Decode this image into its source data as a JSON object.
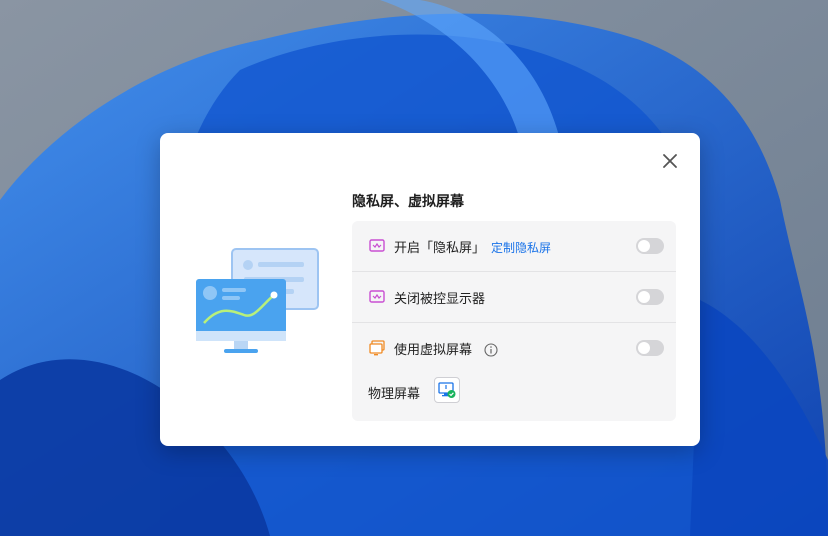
{
  "dialog": {
    "title": "隐私屏、虚拟屏幕",
    "rows": [
      {
        "label": "开启「隐私屏」",
        "link": "定制隐私屏",
        "icon": "privacy-screen-icon",
        "toggle_on": false
      },
      {
        "label": "关闭被控显示器",
        "icon": "monitor-off-icon",
        "toggle_on": false
      },
      {
        "label": "使用虚拟屏幕",
        "icon": "virtual-screen-icon",
        "toggle_on": false
      }
    ],
    "physical_screen_label": "物理屏幕",
    "close_icon": "close-icon"
  },
  "colors": {
    "accent": "#1a73e8",
    "privacy_icon": "#c94fd2",
    "virtual_icon": "#f08a24",
    "toggle_off": "#d5d5d8"
  }
}
